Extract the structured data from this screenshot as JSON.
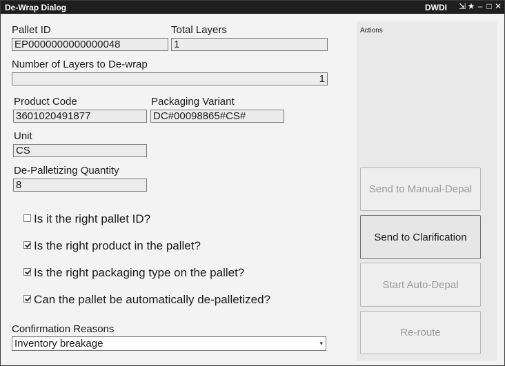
{
  "window": {
    "title": "De-Wrap Dialog",
    "badge": "DWDI",
    "controls": {
      "pin": "⇲",
      "star": "★",
      "minimize": "–",
      "maximize": "□",
      "close": "✕"
    }
  },
  "fields": {
    "pallet_id": {
      "label": "Pallet ID",
      "value": "EP0000000000000048"
    },
    "total_layers": {
      "label": "Total Layers",
      "value": "1"
    },
    "layers_to_dewrap": {
      "label": "Number of Layers to De-wrap",
      "value": "1"
    },
    "product_code": {
      "label": "Product Code",
      "value": "3601020491877"
    },
    "packaging_variant": {
      "label": "Packaging Variant",
      "value": "DC#00098865#CS#"
    },
    "unit": {
      "label": "Unit",
      "value": "CS"
    },
    "depal_quantity": {
      "label": "De-Palletizing Quantity",
      "value": "8"
    }
  },
  "checks": [
    {
      "label": "Is it the right pallet ID?",
      "checked": false
    },
    {
      "label": "Is the right product in the pallet?",
      "checked": true
    },
    {
      "label": "Is the right packaging type on the pallet?",
      "checked": true
    },
    {
      "label": "Can the pallet be automatically de-palletized?",
      "checked": true
    }
  ],
  "confirmation": {
    "label": "Confirmation Reasons",
    "selected": "Inventory breakage",
    "caret": "▾"
  },
  "actions": {
    "title": "Actions",
    "buttons": [
      {
        "label": "Send to Manual-Depal",
        "enabled": false
      },
      {
        "label": "Send to Clarification",
        "enabled": true
      },
      {
        "label": "Start Auto-Depal",
        "enabled": false
      },
      {
        "label": "Re-route",
        "enabled": false
      }
    ]
  }
}
